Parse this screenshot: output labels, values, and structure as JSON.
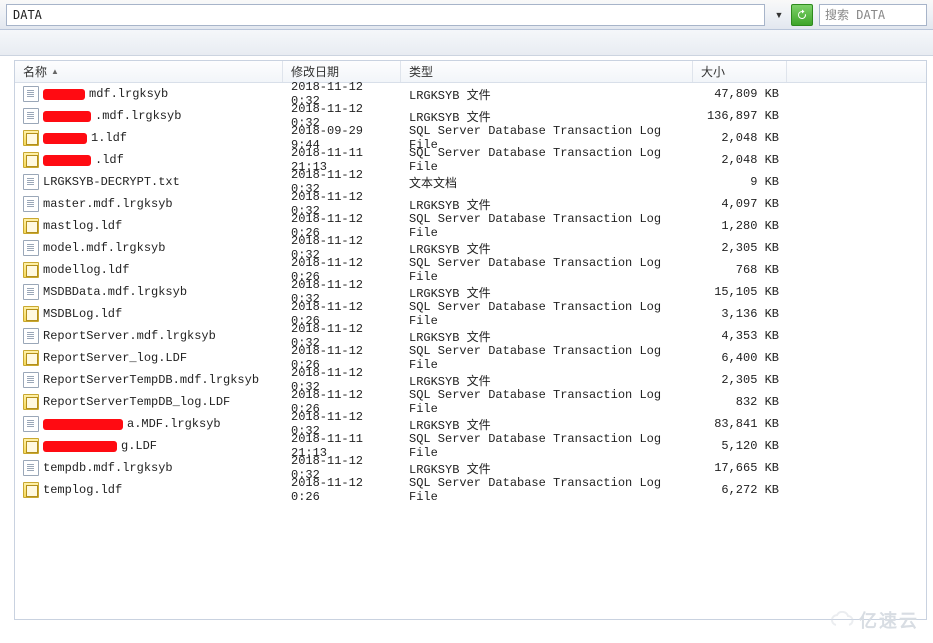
{
  "toolbar": {
    "path": "DATA",
    "search_placeholder": "搜索 DATA"
  },
  "columns": {
    "name": "名称",
    "date": "修改日期",
    "type": "类型",
    "size": "大小"
  },
  "files": [
    {
      "icon": "txt",
      "redact_w": 42,
      "suffix": " mdf.lrgksyb",
      "date": "2018-11-12 0:32",
      "type": "LRGKSYB 文件",
      "size": "47,809 KB"
    },
    {
      "icon": "txt",
      "redact_w": 48,
      "suffix": ".mdf.lrgksyb",
      "date": "2018-11-12 0:32",
      "type": "LRGKSYB 文件",
      "size": "136,897 KB"
    },
    {
      "icon": "ldf",
      "redact_w": 44,
      "suffix": "1.ldf",
      "date": "2018-09-29 9:44",
      "type": "SQL Server Database Transaction Log File",
      "size": "2,048 KB"
    },
    {
      "icon": "ldf",
      "redact_w": 48,
      "suffix": ".ldf",
      "date": "2018-11-11 21:13",
      "type": "SQL Server Database Transaction Log File",
      "size": "2,048 KB"
    },
    {
      "icon": "txt",
      "redact_w": 0,
      "suffix": "LRGKSYB-DECRYPT.txt",
      "date": "2018-11-12 0:32",
      "type": "文本文档",
      "size": "9 KB"
    },
    {
      "icon": "txt",
      "redact_w": 0,
      "suffix": "master.mdf.lrgksyb",
      "date": "2018-11-12 0:32",
      "type": "LRGKSYB 文件",
      "size": "4,097 KB"
    },
    {
      "icon": "ldf",
      "redact_w": 0,
      "suffix": "mastlog.ldf",
      "date": "2018-11-12 0:26",
      "type": "SQL Server Database Transaction Log File",
      "size": "1,280 KB"
    },
    {
      "icon": "txt",
      "redact_w": 0,
      "suffix": "model.mdf.lrgksyb",
      "date": "2018-11-12 0:32",
      "type": "LRGKSYB 文件",
      "size": "2,305 KB"
    },
    {
      "icon": "ldf",
      "redact_w": 0,
      "suffix": "modellog.ldf",
      "date": "2018-11-12 0:26",
      "type": "SQL Server Database Transaction Log File",
      "size": "768 KB"
    },
    {
      "icon": "txt",
      "redact_w": 0,
      "suffix": "MSDBData.mdf.lrgksyb",
      "date": "2018-11-12 0:32",
      "type": "LRGKSYB 文件",
      "size": "15,105 KB"
    },
    {
      "icon": "ldf",
      "redact_w": 0,
      "suffix": "MSDBLog.ldf",
      "date": "2018-11-12 0:26",
      "type": "SQL Server Database Transaction Log File",
      "size": "3,136 KB"
    },
    {
      "icon": "txt",
      "redact_w": 0,
      "suffix": "ReportServer.mdf.lrgksyb",
      "date": "2018-11-12 0:32",
      "type": "LRGKSYB 文件",
      "size": "4,353 KB"
    },
    {
      "icon": "ldf",
      "redact_w": 0,
      "suffix": "ReportServer_log.LDF",
      "date": "2018-11-12 0:26",
      "type": "SQL Server Database Transaction Log File",
      "size": "6,400 KB"
    },
    {
      "icon": "txt",
      "redact_w": 0,
      "suffix": "ReportServerTempDB.mdf.lrgksyb",
      "date": "2018-11-12 0:32",
      "type": "LRGKSYB 文件",
      "size": "2,305 KB"
    },
    {
      "icon": "ldf",
      "redact_w": 0,
      "suffix": "ReportServerTempDB_log.LDF",
      "date": "2018-11-12 0:26",
      "type": "SQL Server Database Transaction Log File",
      "size": "832 KB"
    },
    {
      "icon": "txt",
      "redact_w": 80,
      "suffix": "a.MDF.lrgksyb",
      "date": "2018-11-12 0:32",
      "type": "LRGKSYB 文件",
      "size": "83,841 KB"
    },
    {
      "icon": "ldf",
      "redact_w": 74,
      "suffix": "g.LDF",
      "date": "2018-11-11 21:13",
      "type": "SQL Server Database Transaction Log File",
      "size": "5,120 KB"
    },
    {
      "icon": "txt",
      "redact_w": 0,
      "suffix": "tempdb.mdf.lrgksyb",
      "date": "2018-11-12 0:32",
      "type": "LRGKSYB 文件",
      "size": "17,665 KB"
    },
    {
      "icon": "ldf",
      "redact_w": 0,
      "suffix": "templog.ldf",
      "date": "2018-11-12 0:26",
      "type": "SQL Server Database Transaction Log File",
      "size": "6,272 KB"
    }
  ],
  "watermark": "亿速云"
}
